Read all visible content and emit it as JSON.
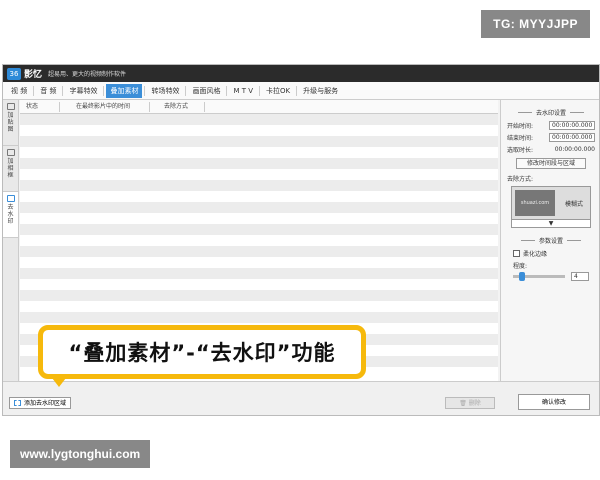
{
  "watermark": {
    "tg": "TG: MYYJJPP",
    "site": "www.lygtonghui.com"
  },
  "titlebar": {
    "app_name": "影忆",
    "slogan": "超易用、更大的视频制作软件"
  },
  "tabs": [
    {
      "label": "视 频"
    },
    {
      "label": "音 频"
    },
    {
      "label": "字幕特效"
    },
    {
      "label": "叠加素材"
    },
    {
      "label": "转场特效"
    },
    {
      "label": "画面风格"
    },
    {
      "label": "M T V"
    },
    {
      "label": "卡拉OK"
    },
    {
      "label": "升级与服务"
    }
  ],
  "left_panel": [
    "加贴图",
    "加相框",
    "去水印"
  ],
  "table": {
    "headers": [
      "状态",
      "在最终影片中的时间",
      "去除方式"
    ]
  },
  "right_panel": {
    "section1": "去水印设置",
    "start_label": "开始时间:",
    "start_value": "00:00:00.000",
    "end_label": "结束时间:",
    "end_value": "00:00:00.000",
    "duration_label": "选取时长:",
    "duration_value": "00:00:00.000",
    "modify_button": "修改时间段与区域",
    "method_label": "去除方式:",
    "method_thumb": "shuazi.com",
    "method_value": "模糊式",
    "section2": "参数设置",
    "soften_label": "柔化边缘",
    "degree_label": "程度:",
    "degree_value": "4"
  },
  "bottom": {
    "add_button": "添加去水印区域",
    "delete_button": "删除",
    "ok_button": "确认修改"
  },
  "banner": {
    "text": "“叠加素材”-“去水印”功能"
  },
  "colors": {
    "accent": "#3b8ed8",
    "banner_border": "#f6b90c"
  }
}
